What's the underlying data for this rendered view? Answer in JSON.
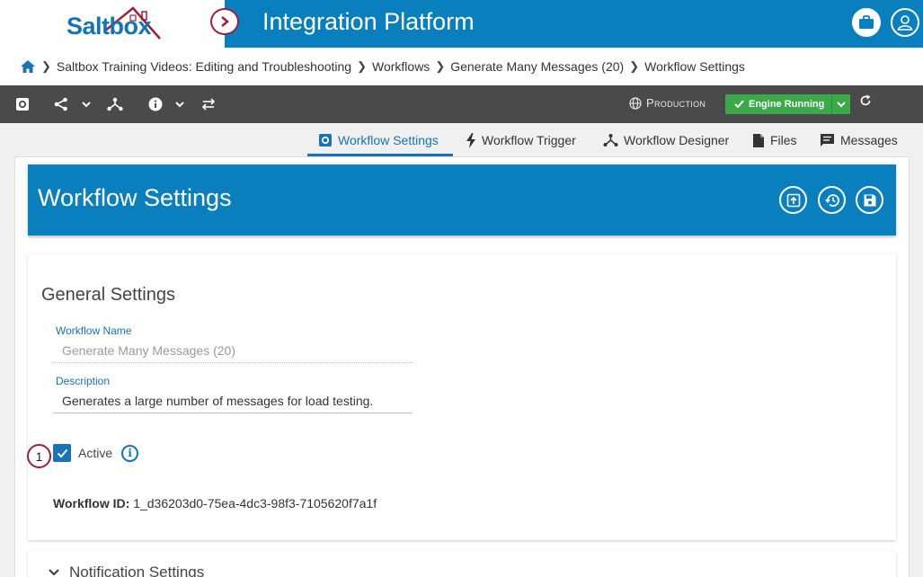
{
  "header": {
    "logo_text": "Saltbox",
    "title": "Integration Platform"
  },
  "breadcrumb": {
    "items": [
      "Saltbox Training Videos: Editing and Troubleshooting",
      "Workflows",
      "Generate Many Messages (20)",
      "Workflow Settings"
    ]
  },
  "toolbar": {
    "environment": "Production",
    "engine_status": "Engine Running"
  },
  "tabs": [
    {
      "label": "Workflow Settings",
      "icon": "gear-icon",
      "active": true
    },
    {
      "label": "Workflow Trigger",
      "icon": "lightning-icon",
      "active": false
    },
    {
      "label": "Workflow Designer",
      "icon": "flow-icon",
      "active": false
    },
    {
      "label": "Files",
      "icon": "file-icon",
      "active": false
    },
    {
      "label": "Messages",
      "icon": "message-icon",
      "active": false
    }
  ],
  "banner": {
    "title": "Workflow Settings"
  },
  "general": {
    "title": "General Settings",
    "name_label": "Workflow Name",
    "name_value": "Generate Many Messages (20)",
    "desc_label": "Description",
    "desc_value": "Generates a large number of messages for load testing.",
    "active_label": "Active",
    "active_checked": true,
    "id_label": "Workflow ID:",
    "id_value": "1_d36203d0-75ea-4dc3-98f3-7105620f7a1f"
  },
  "step_badge": "1",
  "notification": {
    "title": "Notification Settings"
  },
  "colors": {
    "primary": "#0a7fbd",
    "accent": "#1673b6",
    "brand_red": "#9a2040",
    "success": "#3aa94a",
    "toolbar": "#4a4a4a"
  }
}
